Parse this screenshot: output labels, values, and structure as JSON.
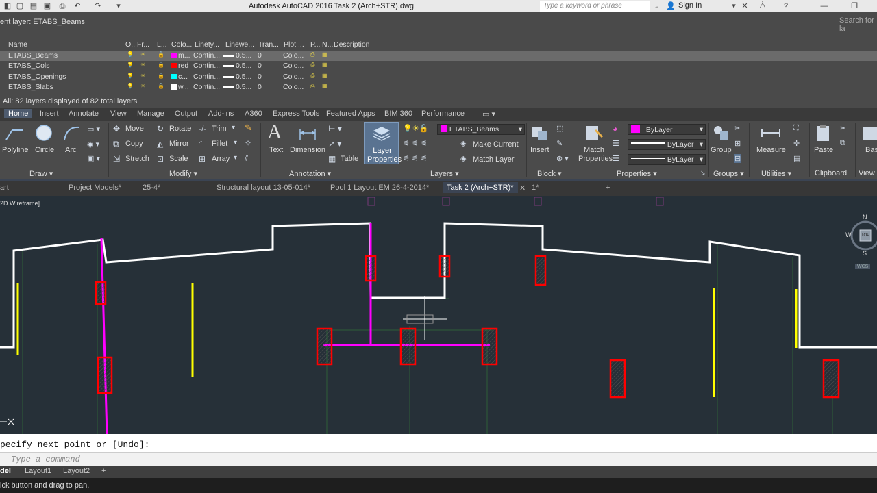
{
  "app": {
    "title": "Autodesk AutoCAD 2016    Task 2 (Arch+STR).dwg",
    "search_placeholder": "Type a keyword or phrase",
    "sign_in": "Sign In"
  },
  "layer_panel": {
    "current_layer": "ent layer: ETABS_Beams",
    "search_for": "Search for la",
    "columns": [
      "Name",
      "O..",
      "Fr...",
      "L...",
      "Colo...",
      "Linety...",
      "Linewe...",
      "Tran...",
      "Plot ...",
      "P...",
      "N...",
      "Description"
    ],
    "rows": [
      {
        "name": "ETABS_Beams",
        "color": "m...",
        "linetype": "Contin...",
        "lineweight": "0.5...",
        "transparency": "0",
        "plot": "Colo...",
        "swatch": "#ff00ff"
      },
      {
        "name": "ETABS_Cols",
        "color": "red",
        "linetype": "Contin...",
        "lineweight": "0.5...",
        "transparency": "0",
        "plot": "Colo...",
        "swatch": "#ff0000"
      },
      {
        "name": "ETABS_Openings",
        "color": "c...",
        "linetype": "Contin...",
        "lineweight": "0.5...",
        "transparency": "0",
        "plot": "Colo...",
        "swatch": "#00ffff"
      },
      {
        "name": "ETABS_Slabs",
        "color": "w...",
        "linetype": "Contin...",
        "lineweight": "0.5...",
        "transparency": "0",
        "plot": "Colo...",
        "swatch": "#ffffff"
      }
    ],
    "status": "All: 82 layers displayed of 82 total layers"
  },
  "ribbon_tabs": [
    "Home",
    "Insert",
    "Annotate",
    "View",
    "Manage",
    "Output",
    "Add-ins",
    "A360",
    "Express Tools",
    "Featured Apps",
    "BIM 360",
    "Performance"
  ],
  "ribbon": {
    "draw": {
      "polyline": "Polyline",
      "circle": "Circle",
      "arc": "Arc",
      "panel": "Draw ▾"
    },
    "modify": {
      "move": "Move",
      "rotate": "Rotate",
      "trim": "Trim",
      "copy": "Copy",
      "mirror": "Mirror",
      "fillet": "Fillet",
      "stretch": "Stretch",
      "scale": "Scale",
      "array": "Array",
      "panel": "Modify ▾"
    },
    "annotation": {
      "text": "Text",
      "dimension": "Dimension",
      "table": "Table",
      "panel": "Annotation ▾"
    },
    "layers": {
      "layer_properties": "Layer Properties",
      "current": "ETABS_Beams",
      "make_current": "Make Current",
      "match_layer": "Match Layer",
      "panel": "Layers ▾"
    },
    "block": {
      "insert": "Insert",
      "panel": "Block ▾"
    },
    "properties": {
      "match": "Match Properties",
      "color": "ByLayer",
      "linetype": "ByLayer",
      "lineweight": "ByLayer",
      "panel": "Properties ▾"
    },
    "groups": {
      "group": "Group",
      "panel": "Groups ▾"
    },
    "utilities": {
      "measure": "Measure",
      "panel": "Utilities ▾"
    },
    "clipboard": {
      "paste": "Paste",
      "panel": "Clipboard"
    },
    "view": {
      "base": "Bas",
      "panel": "View"
    }
  },
  "doc_tabs": [
    "art",
    "Project Models*",
    "25-4*",
    "Structural layout 13-05-014*",
    "Pool 1 Layout EM 26-4-2014*",
    "Task 2 (Arch+STR)*",
    "1*"
  ],
  "viewport": {
    "label": "2D Wireframe]",
    "compass": {
      "n": "N",
      "w": "W",
      "s": "S",
      "top": "TOP",
      "wcs": "WCS"
    }
  },
  "command": {
    "history": "pecify next point or [Undo]:",
    "prompt": "Type a command"
  },
  "layout_tabs": [
    "del",
    "Layout1",
    "Layout2",
    "+"
  ],
  "status": "ick button and drag to pan.",
  "colors": {
    "beam": "#ff00ff",
    "column": "#ff0000",
    "wall": "#ffffff",
    "opening": "#ffff00",
    "background": "#263038"
  }
}
